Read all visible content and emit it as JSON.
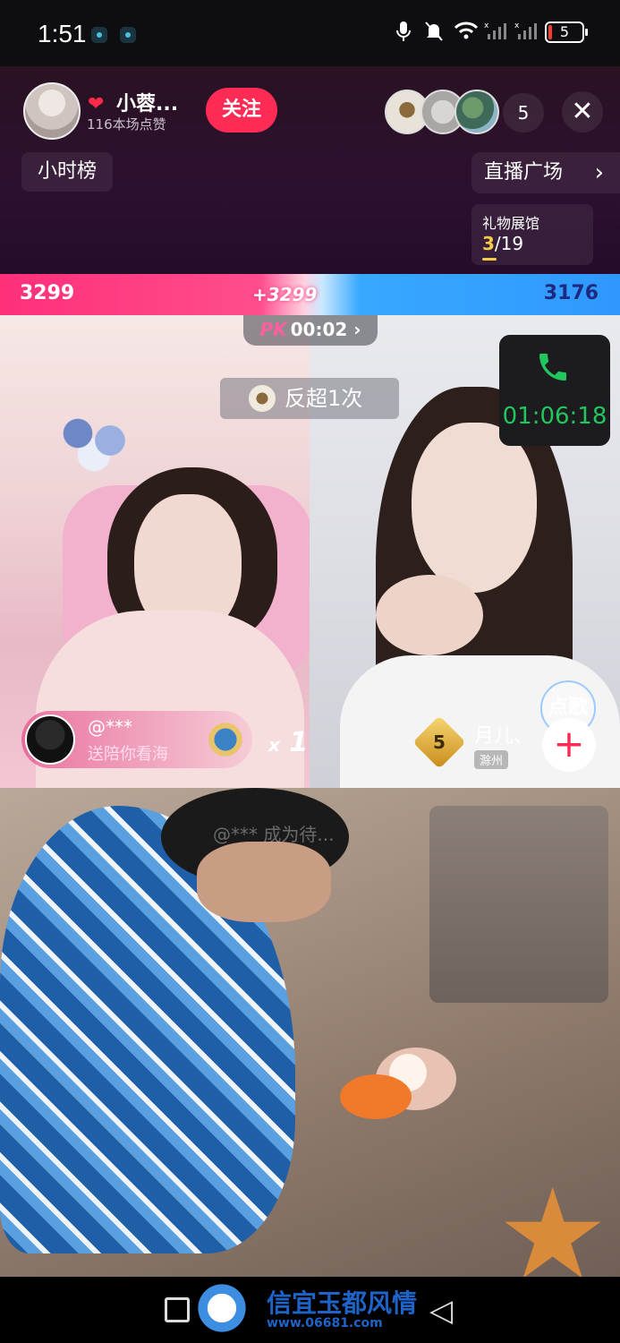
{
  "status_bar": {
    "time": "1:51",
    "battery": "5",
    "icons": [
      "mic-icon",
      "mute-icon",
      "wifi-icon",
      "signal-icon",
      "signal-icon"
    ]
  },
  "header": {
    "anchor_name": "小蓉...",
    "anchor_likes": "116本场点赞",
    "follow_label": "关注",
    "viewer_count": "5",
    "close_glyph": "✕",
    "hour_rank_label": "小时榜",
    "live_square_label": "直播广场",
    "gift_hall": {
      "title": "礼物展馆",
      "current": "3",
      "total": "/19"
    }
  },
  "pk": {
    "left_score": "3299",
    "right_score": "3176",
    "delta": "+3299",
    "logo": "PK",
    "timer": "00:02",
    "reversal_text": "反超1次",
    "colors": {
      "left": "#ff2f7a",
      "right": "#2f98ff"
    }
  },
  "call": {
    "duration": "01:06:18",
    "color": "#22c55e"
  },
  "gift_notice": {
    "user": "@***",
    "message": "送陪你看海",
    "combo_x": "x",
    "combo_count": "1"
  },
  "opponent": {
    "level": "5",
    "name": "月儿、",
    "location": "滁州",
    "song_label": "点歌",
    "add_glyph": "+"
  },
  "scene": {
    "overlay_text": "@*** 成为待..."
  },
  "watermark": {
    "title": "信宜玉都风情",
    "url": "www.06681.com"
  }
}
